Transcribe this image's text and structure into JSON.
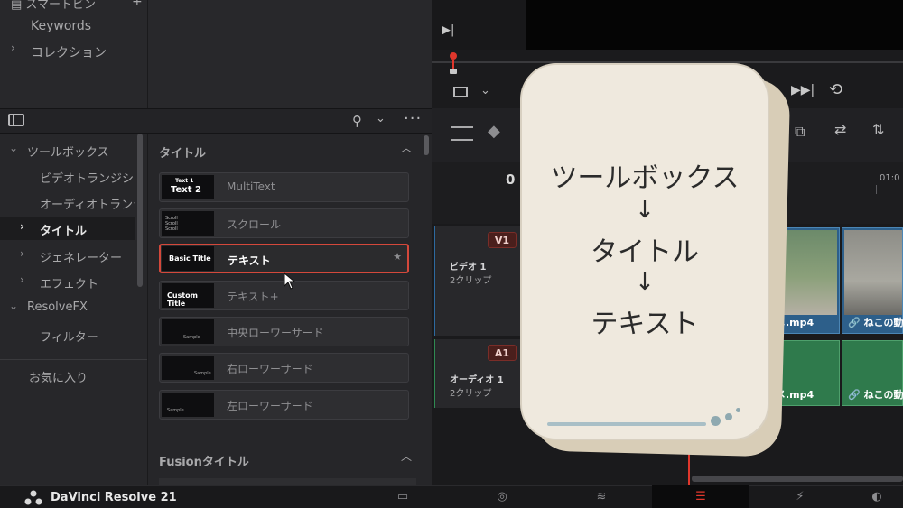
{
  "bin": {
    "smart_bins": "スマートビン",
    "items": [
      "Keywords",
      "コレクション"
    ]
  },
  "effects_tree": {
    "items": [
      {
        "label": "ツールボックス",
        "expanded": true
      },
      {
        "label": "ビデオトランジション"
      },
      {
        "label": "オーディオトランジ..."
      },
      {
        "label": "タイトル",
        "selected": true
      },
      {
        "label": "ジェネレーター"
      },
      {
        "label": "エフェクト"
      },
      {
        "label": "ResolveFX",
        "expanded": true
      },
      {
        "label": "フィルター"
      }
    ],
    "favorites": "お気に入り"
  },
  "title_list": {
    "section": "タイトル",
    "items": [
      {
        "name": "MultiText",
        "thumb": "Text 1 / Text 2"
      },
      {
        "name": "スクロール",
        "thumb": "Scroll"
      },
      {
        "name": "テキスト",
        "thumb": "Basic Title",
        "selected": true
      },
      {
        "name": "テキスト+",
        "thumb": "Custom Title"
      },
      {
        "name": "中央ローワーサード",
        "thumb": "Sample"
      },
      {
        "name": "右ローワーサード",
        "thumb": "Sample"
      },
      {
        "name": "左ローワーサード",
        "thumb": "Sample"
      }
    ],
    "fusion_section": "Fusionタイトル"
  },
  "timeline": {
    "timecode_left": "0",
    "timecode_right": "01:0",
    "video_track": {
      "badge": "V1",
      "name": "ビデオ 1",
      "clips": "2クリップ"
    },
    "audio_track": {
      "badge": "A1",
      "name": "オーディオ 1",
      "clips": "2クリップ"
    },
    "clip_labels": {
      "video_a": "メ.mp4",
      "video_b": "ねこの動",
      "audio_a": "メ.mp4",
      "audio_b": "ねこの動"
    }
  },
  "overlay_card": {
    "line1": "ツールボックス",
    "arrow": "↓",
    "line2": "タイトル",
    "line3": "テキスト"
  },
  "bottom_bar": {
    "app_name": "DaVinci Resolve 21"
  },
  "colors": {
    "selection_red": "#d4483b",
    "video_clip": "#2d5f8a",
    "audio_clip": "#2f7a4c"
  }
}
